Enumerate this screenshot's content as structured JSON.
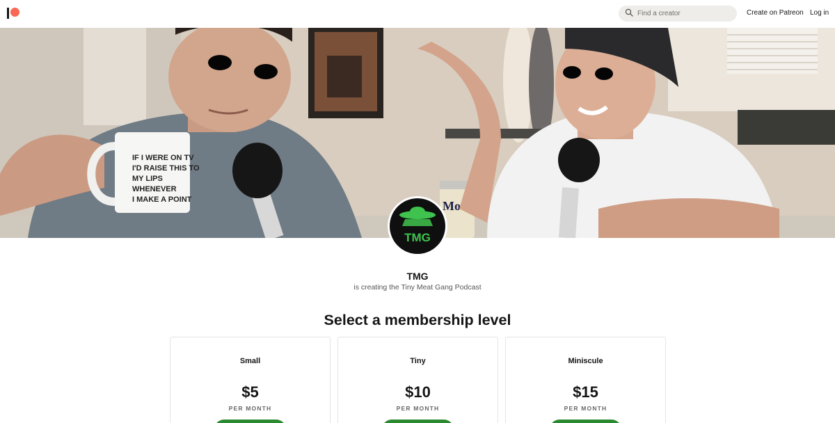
{
  "nav": {
    "search_placeholder": "Find a creator",
    "create_label": "Create on Patreon",
    "login_label": "Log in"
  },
  "cover": {
    "mug_text": [
      "IF I WERE ON TV",
      "I'D RAISE THIS TO",
      "MY LIPS",
      "WHENEVER",
      "I MAKE A POINT"
    ],
    "can_text": "Modelo"
  },
  "creator": {
    "name": "TMG",
    "subtitle": "is creating the Tiny Meat Gang Podcast",
    "avatar_text": "TMG"
  },
  "membership": {
    "title": "Select a membership level",
    "tiers": [
      {
        "name": "Small",
        "price": "$5",
        "period": "PER MONTH"
      },
      {
        "name": "Tiny",
        "price": "$10",
        "period": "PER MONTH"
      },
      {
        "name": "Miniscule",
        "price": "$15",
        "period": "PER MONTH"
      }
    ]
  },
  "colors": {
    "brand": "#f96854",
    "join_button": "#2b8a2f",
    "avatar_green": "#3fc24e"
  },
  "icons": {
    "logo": "patreon-logo",
    "search": "search-icon"
  }
}
